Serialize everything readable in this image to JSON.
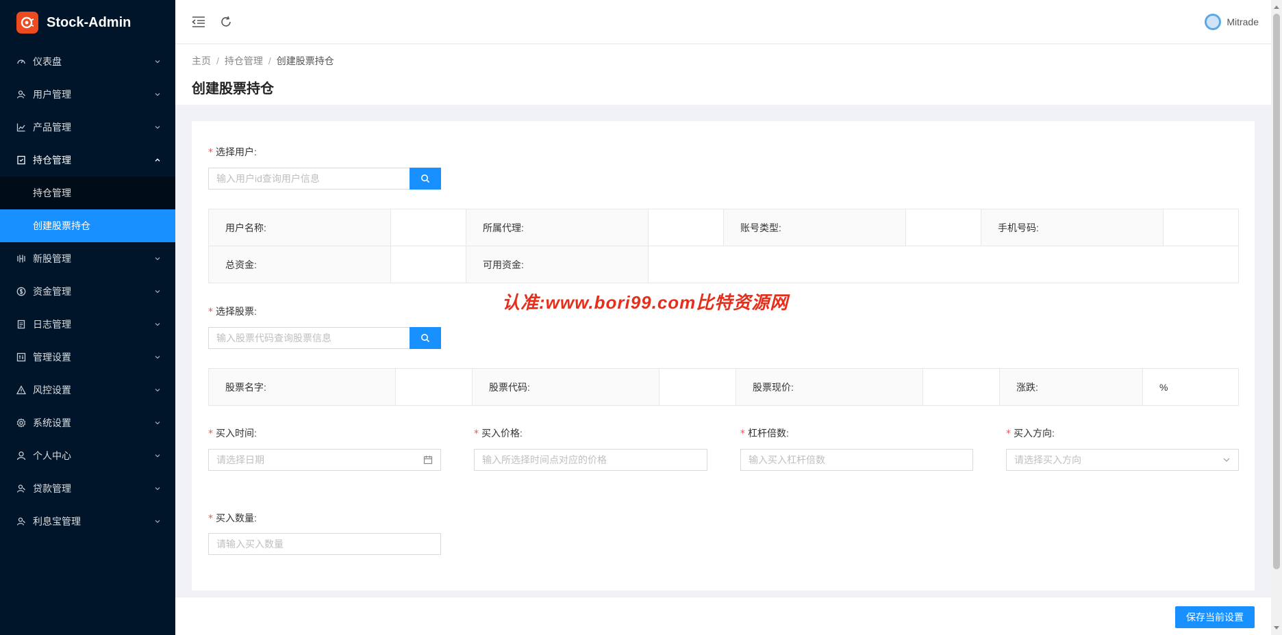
{
  "app": {
    "name": "Stock-Admin"
  },
  "sidebar": {
    "items": [
      {
        "label": "仪表盘",
        "icon": "dashboard-icon"
      },
      {
        "label": "用户管理",
        "icon": "users-icon"
      },
      {
        "label": "产品管理",
        "icon": "chart-icon"
      },
      {
        "label": "持仓管理",
        "icon": "holdings-icon",
        "open": true,
        "children": [
          {
            "label": "持仓管理"
          },
          {
            "label": "创建股票持仓",
            "active": true
          }
        ]
      },
      {
        "label": "新股管理",
        "icon": "ipo-icon"
      },
      {
        "label": "资金管理",
        "icon": "money-icon"
      },
      {
        "label": "日志管理",
        "icon": "log-icon"
      },
      {
        "label": "管理设置",
        "icon": "admin-settings-icon"
      },
      {
        "label": "风控设置",
        "icon": "warning-icon"
      },
      {
        "label": "系统设置",
        "icon": "gear-icon"
      },
      {
        "label": "个人中心",
        "icon": "person-icon"
      },
      {
        "label": "贷款管理",
        "icon": "loan-icon"
      },
      {
        "label": "利息宝管理",
        "icon": "interest-icon"
      }
    ]
  },
  "header": {
    "user_name": "Mitrade"
  },
  "breadcrumb": {
    "home": "主页",
    "parent": "持仓管理",
    "current": "创建股票持仓"
  },
  "page": {
    "title": "创建股票持仓"
  },
  "form": {
    "user": {
      "label": "选择用户:",
      "placeholder": "输入用户id查询用户信息"
    },
    "user_info": {
      "name_key": "用户名称:",
      "name_val": "",
      "agent_key": "所属代理:",
      "agent_val": "",
      "account_type_key": "账号类型:",
      "account_type_val": "",
      "phone_key": "手机号码:",
      "phone_val": "",
      "total_funds_key": "总资金:",
      "total_funds_val": "",
      "available_funds_key": "可用资金:",
      "available_funds_val": ""
    },
    "stock": {
      "label": "选择股票:",
      "placeholder": "输入股票代码查询股票信息"
    },
    "stock_info": {
      "name_key": "股票名字:",
      "name_val": "",
      "code_key": "股票代码:",
      "code_val": "",
      "price_key": "股票现价:",
      "price_val": "",
      "change_key": "涨跌:",
      "change_val": "%"
    },
    "buy_time": {
      "label": "买入时间:",
      "placeholder": "请选择日期"
    },
    "buy_price": {
      "label": "买入价格:",
      "placeholder": "输入所选择时间点对应的价格"
    },
    "leverage": {
      "label": "杠杆倍数:",
      "placeholder": "输入买入杠杆倍数"
    },
    "direction": {
      "label": "买入方向:",
      "placeholder": "请选择买入方向"
    },
    "quantity": {
      "label": "买入数量:",
      "placeholder": "请输入买入数量"
    }
  },
  "watermark": "认准:www.bori99.com比特资源网",
  "footer": {
    "save_label": "保存当前设置"
  },
  "colors": {
    "primary": "#1890ff",
    "sidebar_bg": "#001529",
    "required": "#ff4d4f",
    "watermark": "#e62e1b"
  }
}
